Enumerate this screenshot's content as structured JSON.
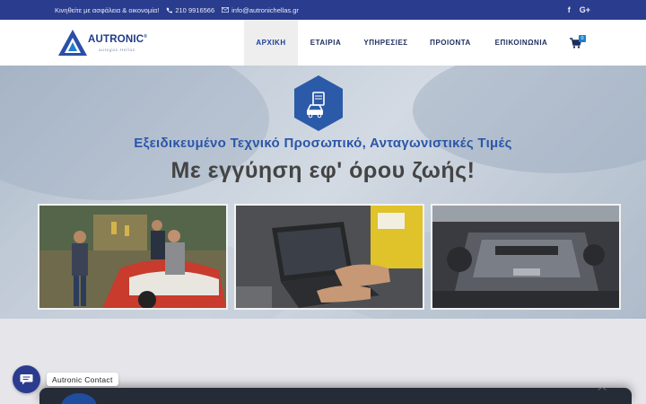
{
  "topbar": {
    "slogan": "Κινηθείτε με ασφάλεια & οικονομία!",
    "phone": "210 9916566",
    "email": "info@autronichellas.gr",
    "social": [
      {
        "icon": "facebook-icon",
        "label": "f"
      },
      {
        "icon": "google-plus-icon",
        "label": "G+"
      }
    ]
  },
  "header": {
    "logo": {
      "brand": "AUTRONIC",
      "reg": "®",
      "tagline": "autogas Hellas"
    },
    "nav": [
      {
        "label": "ΑΡΧΙΚΗ",
        "active": true
      },
      {
        "label": "ΕΤΑΙΡΙΑ",
        "active": false
      },
      {
        "label": "ΥΠΗΡΕΣΙΕΣ",
        "active": false
      },
      {
        "label": "ΠΡΟΙΟΝΤΑ",
        "active": false
      },
      {
        "label": "ΕΠΙΚΟΙΝΩΝΙΑ",
        "active": false
      }
    ],
    "cart": {
      "icon": "cart-icon",
      "count": "0"
    }
  },
  "hero": {
    "icon": "car-diagnostic-icon",
    "headline": "Εξειδικευμένο Τεχνικό Προσωπικό, Ανταγωνιστικές Τιμές",
    "subheadline": "Με εγγύηση εφ' όρου ζωής!",
    "photos": [
      {
        "name": "team-photo"
      },
      {
        "name": "laptop-diagnostics-photo"
      },
      {
        "name": "engine-bay-photo"
      }
    ]
  },
  "chat": {
    "label": "Autronic Contact",
    "icon": "chat-icon"
  },
  "scroll_top": {
    "icon": "chevron-up-icon",
    "glyph": "︿"
  },
  "colors": {
    "primary": "#2a3c8e",
    "accent": "#2b56a8",
    "badge": "#1d7fd1"
  }
}
